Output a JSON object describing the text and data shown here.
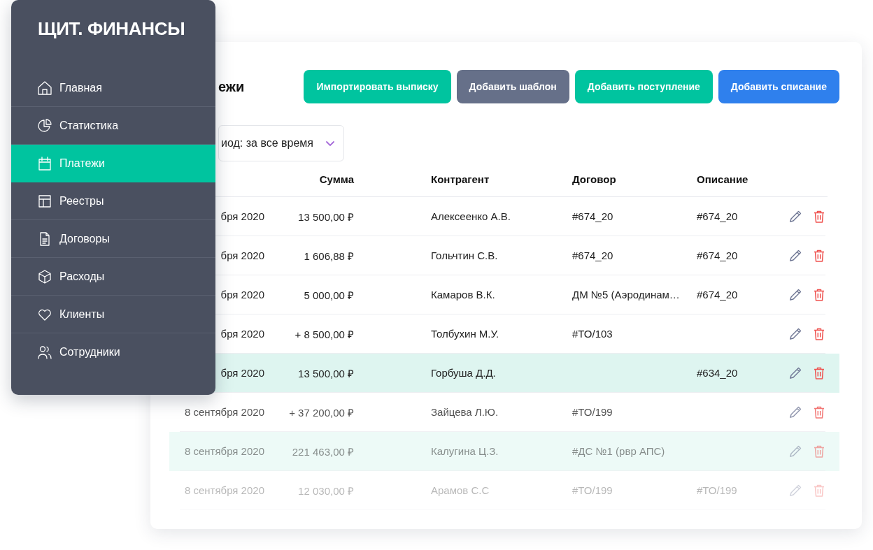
{
  "sidebar": {
    "logo": "ЩИТ. ФИНАНСЫ",
    "items": [
      {
        "label": "Главная",
        "selected": false
      },
      {
        "label": "Статистика",
        "selected": false
      },
      {
        "label": "Платежи",
        "selected": true
      },
      {
        "label": "Реестры",
        "selected": false
      },
      {
        "label": "Договоры",
        "selected": false
      },
      {
        "label": "Расходы",
        "selected": false
      },
      {
        "label": "Клиенты",
        "selected": false
      },
      {
        "label": "Сотрудники",
        "selected": false
      }
    ]
  },
  "page": {
    "title": "ежи",
    "buttons": [
      {
        "label": "Импортировать выписку",
        "kind": "teal"
      },
      {
        "label": "Добавить шаблон",
        "kind": "gray"
      },
      {
        "label": "Добавить поступление",
        "kind": "teal"
      },
      {
        "label": "Добавить списание",
        "kind": "blue"
      }
    ],
    "period_filter": {
      "value": "иод: за все время"
    }
  },
  "table": {
    "columns": [
      "Сумма",
      "Контрагент",
      "Договор",
      "Описание"
    ],
    "rows": [
      {
        "date": "бря 2020",
        "amount": "13 500,00 ₽",
        "counterparty": "Алексеенко А.В.",
        "contract": "#674_20",
        "description": "#674_20",
        "highlighted": false
      },
      {
        "date": "бря 2020",
        "amount": "1 606,88 ₽",
        "counterparty": "Гольчтин С.В.",
        "contract": "#674_20",
        "description": "#674_20",
        "highlighted": false
      },
      {
        "date": "бря 2020",
        "amount": "5 000,00 ₽",
        "counterparty": "Камаров В.К.",
        "contract": "ДМ №5 (Аэродинам…",
        "description": "#674_20",
        "highlighted": false
      },
      {
        "date": "бря 2020",
        "amount": "+ 8 500,00 ₽",
        "counterparty": "Толбухин М.У.",
        "contract": "#ТО/103",
        "highlighted": false
      },
      {
        "date": "бря 2020",
        "amount": "13 500,00 ₽",
        "counterparty": "Горбуша Д.Д.",
        "description": "#634_20",
        "highlighted": true
      },
      {
        "date": "8 сентября 2020",
        "amount": "+ 37 200,00 ₽",
        "counterparty": "Зайцева Л.Ю.",
        "contract": "#ТО/199",
        "highlighted": false
      },
      {
        "date": "8 сентября 2020",
        "amount": "221 463,00 ₽",
        "counterparty": "Калугина Ц.З.",
        "contract": "#ДС №1 (рвр АПС)",
        "highlighted": true
      },
      {
        "date": "8 сентября 2020",
        "amount": "12 030,00 ₽",
        "counterparty": "Арамов С.С",
        "contract": "#ТО/199",
        "description": "#ТО/199",
        "highlighted": false
      }
    ]
  }
}
